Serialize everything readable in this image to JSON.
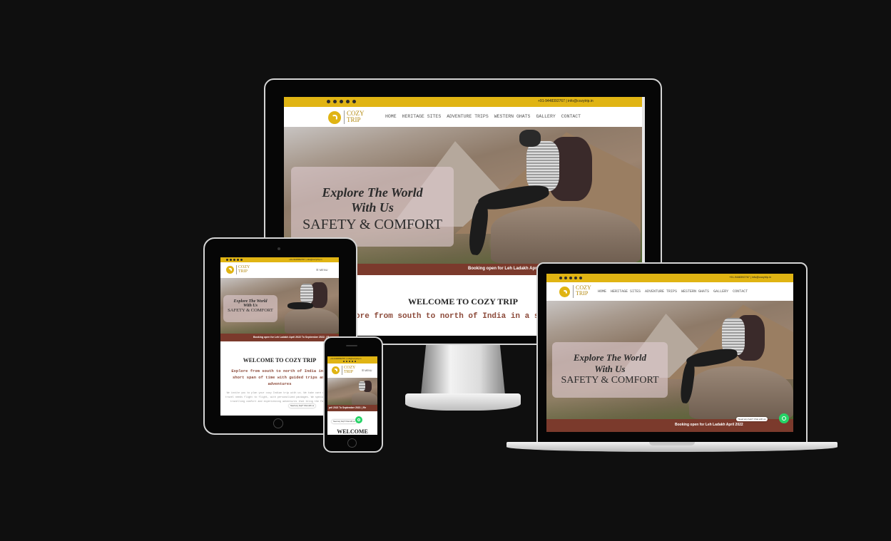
{
  "site": {
    "logo_line1": "COZY",
    "logo_line2": "TRIP",
    "contact": "+91-9448392767 | info@cozytrip.in",
    "nav": [
      "HOME",
      "HERITAGE SITES",
      "ADVENTURE TRIPS",
      "WESTERN GHATS",
      "GALLERY",
      "CONTACT"
    ],
    "menu_label": "☰ MENU",
    "hero_line1": "Explore The World",
    "hero_line2": "With Us",
    "hero_line3": "SAFETY & COMFORT",
    "booking_desktop": "Booking open for Leh Ladakh April 2022 To",
    "booking_tablet": "Booking open for Leh Ladakh April 2022 To September 2022. | Re",
    "booking_phone": "pril 2022 To September 2022. | Re",
    "booking_laptop": "Booking open for Leh Ladakh April 2022",
    "welcome": "WELCOME TO COZY TRIP",
    "welcome_phone": "WELCOME",
    "tagline_desktop": "ore from south to north of India in a short s",
    "tagline_tablet": "Explore from south to north of India in a short span of time with guided trips and adventures",
    "para_tablet": "We invite you to plan your cozy Indian trip with us. We take care of your travel needs flight to flight, with personalized packages. We specialize in travelling comfort and experiencing adventures that bring the family",
    "whatsapp_text": "Need any help? Chat with us"
  },
  "colors": {
    "brand_yellow": "#e0b413",
    "booking_bar": "#7b3a2c",
    "whatsapp": "#25d366",
    "tagline": "#8c4a3a"
  },
  "icons": [
    "twitter-icon",
    "facebook-icon",
    "instagram-icon",
    "youtube-icon",
    "linkedin-icon",
    "phone-icon",
    "mail-icon",
    "whatsapp-icon",
    "menu-icon",
    "logo-icon"
  ]
}
